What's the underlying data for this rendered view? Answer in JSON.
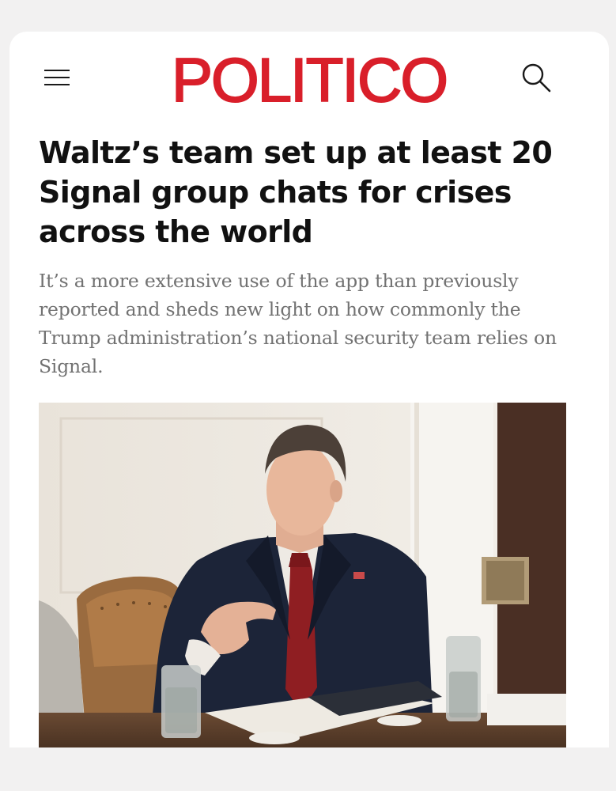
{
  "header": {
    "logo": "POLITICO",
    "menu_icon": "hamburger-menu-icon",
    "search_icon": "search-icon"
  },
  "article": {
    "headline": "Waltz’s team set up at least 20 Signal group chats for crises across the world",
    "dek": "It’s a more extensive use of the app than previously reported and sheds new light on how commonly the Trump administration’s national security team relies on Signal."
  },
  "colors": {
    "brand_red": "#d91f2a",
    "headline": "#111111",
    "dek": "#727272",
    "background": "#f2f1f1"
  }
}
